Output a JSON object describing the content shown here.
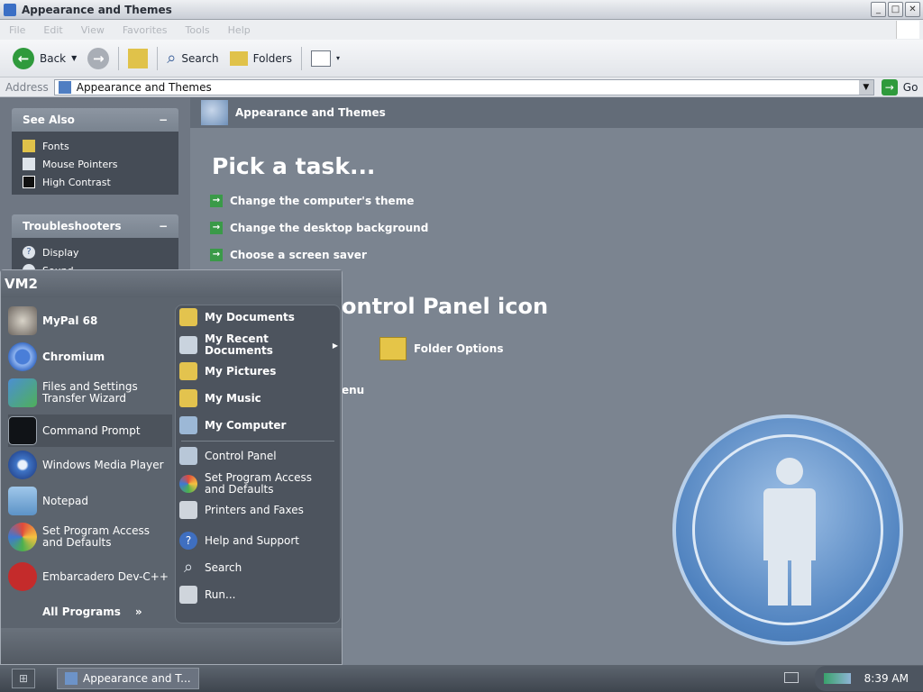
{
  "window": {
    "title": "Appearance and Themes"
  },
  "menubar": {
    "items": [
      "File",
      "Edit",
      "View",
      "Favorites",
      "Tools",
      "Help"
    ]
  },
  "toolbar": {
    "back_label": "Back",
    "search_label": "Search",
    "folders_label": "Folders"
  },
  "addressbar": {
    "label": "Address",
    "value": "Appearance and Themes",
    "go_label": "Go"
  },
  "sidebar": {
    "see_also": {
      "title": "See Also",
      "items": [
        "Fonts",
        "Mouse Pointers",
        "High Contrast"
      ]
    },
    "troubleshooters": {
      "title": "Troubleshooters",
      "items": [
        "Display",
        "Sound"
      ]
    }
  },
  "content": {
    "header": "Appearance and Themes",
    "pick_task": "Pick a task...",
    "tasks": [
      "Change the computer's theme",
      "Change the desktop background",
      "Choose a screen saver"
    ],
    "pick_icon": "ontrol Panel icon",
    "icons": [
      "Folder Options"
    ],
    "taskbar_menu": "enu"
  },
  "startmenu": {
    "user": "VM2",
    "pinned": [
      {
        "label": "MyPal 68",
        "icon": "raccoon-icon"
      },
      {
        "label": "Chromium",
        "icon": "chromium-icon"
      },
      {
        "label": "Files and Settings Transfer Wizard",
        "icon": "transfer-wizard-icon"
      },
      {
        "label": "Command Prompt",
        "icon": "cmd-icon"
      },
      {
        "label": "Windows Media Player",
        "icon": "media-player-icon"
      },
      {
        "label": "Notepad",
        "icon": "notepad-icon"
      },
      {
        "label": "Set Program Access and Defaults",
        "icon": "program-access-icon"
      },
      {
        "label": "Embarcadero Dev-C++",
        "icon": "devcpp-icon"
      }
    ],
    "all_programs": "All Programs",
    "places": [
      {
        "label": "My Documents",
        "icon": "documents-icon"
      },
      {
        "label": "My Recent Documents",
        "icon": "recent-documents-icon"
      },
      {
        "label": "My Pictures",
        "icon": "pictures-icon"
      },
      {
        "label": "My Music",
        "icon": "music-icon"
      },
      {
        "label": "My Computer",
        "icon": "computer-icon"
      }
    ],
    "system": [
      {
        "label": "Control Panel",
        "icon": "control-panel-icon"
      },
      {
        "label": "Set Program Access and Defaults",
        "icon": "program-access-icon"
      },
      {
        "label": "Printers and Faxes",
        "icon": "printer-icon"
      },
      {
        "label": "Help and Support",
        "icon": "help-icon"
      },
      {
        "label": "Search",
        "icon": "search-icon"
      },
      {
        "label": "Run...",
        "icon": "run-icon"
      }
    ]
  },
  "taskbar": {
    "task": "Appearance and T...",
    "clock": "8:39 AM"
  },
  "colors": {
    "background": "#7d8692",
    "accent_green": "#3a9a48",
    "panel_dark": "#454c56"
  }
}
